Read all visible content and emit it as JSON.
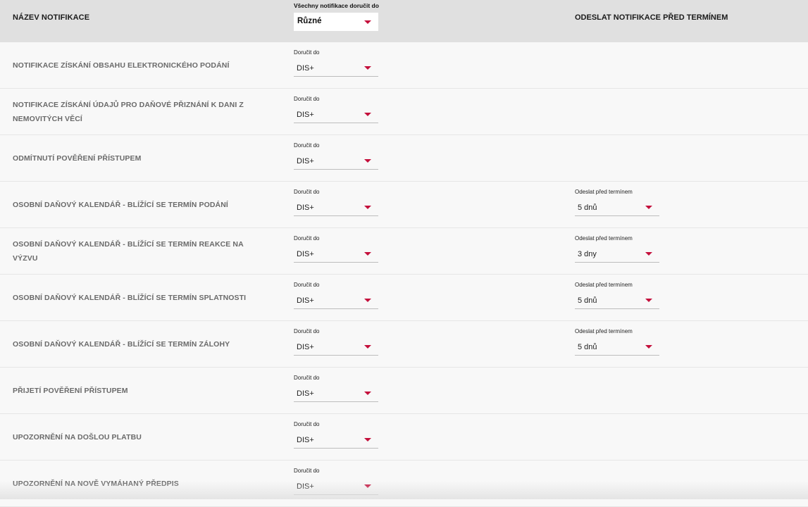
{
  "header": {
    "name_col": "NÁZEV NOTIFIKACE",
    "all_deliver_label": "Všechny notifikace doručit do",
    "all_deliver_value": "Různé",
    "deadline_col": "ODESLAT NOTIFIKACE PŘED TERMÍNEM"
  },
  "labels": {
    "deliver_to": "Doručit do",
    "send_before": "Odeslat před termínem"
  },
  "rows": [
    {
      "name": "NOTIFIKACE ZÍSKÁNÍ OBSAHU ELEKTRONICKÉHO PODÁNÍ",
      "deliver": "DIS+"
    },
    {
      "name": "NOTIFIKACE ZÍSKÁNÍ ÚDAJŮ PRO DAŇOVÉ PŘIZNÁNÍ K DANI Z NEMOVITÝCH VĚCÍ",
      "deliver": "DIS+"
    },
    {
      "name": "ODMÍTNUTÍ POVĚŘENÍ PŘÍSTUPEM",
      "deliver": "DIS+"
    },
    {
      "name": "OSOBNÍ DAŇOVÝ KALENDÁŘ - BLÍŽÍCÍ SE TERMÍN PODÁNÍ",
      "deliver": "DIS+",
      "before": "5 dnů"
    },
    {
      "name": "OSOBNÍ DAŇOVÝ KALENDÁŘ - BLÍŽÍCÍ SE TERMÍN REAKCE NA VÝZVU",
      "deliver": "DIS+",
      "before": "3 dny"
    },
    {
      "name": "OSOBNÍ DAŇOVÝ KALENDÁŘ - BLÍŽÍCÍ SE TERMÍN SPLATNOSTI",
      "deliver": "DIS+",
      "before": "5 dnů"
    },
    {
      "name": "OSOBNÍ DAŇOVÝ KALENDÁŘ - BLÍŽÍCÍ SE TERMÍN ZÁLOHY",
      "deliver": "DIS+",
      "before": "5 dnů"
    },
    {
      "name": "PŘIJETÍ POVĚŘENÍ PŘÍSTUPEM",
      "deliver": "DIS+"
    },
    {
      "name": "UPOZORNĚNÍ NA DOŠLOU PLATBU",
      "deliver": "DIS+"
    },
    {
      "name": "UPOZORNĚNÍ NA NOVĚ VYMÁHANÝ PŘEDPIS",
      "deliver": "DIS+"
    }
  ],
  "colors": {
    "accent": "#c4103c",
    "header_bg": "#e0e0e0",
    "row_bg": "#f8f8f8"
  }
}
